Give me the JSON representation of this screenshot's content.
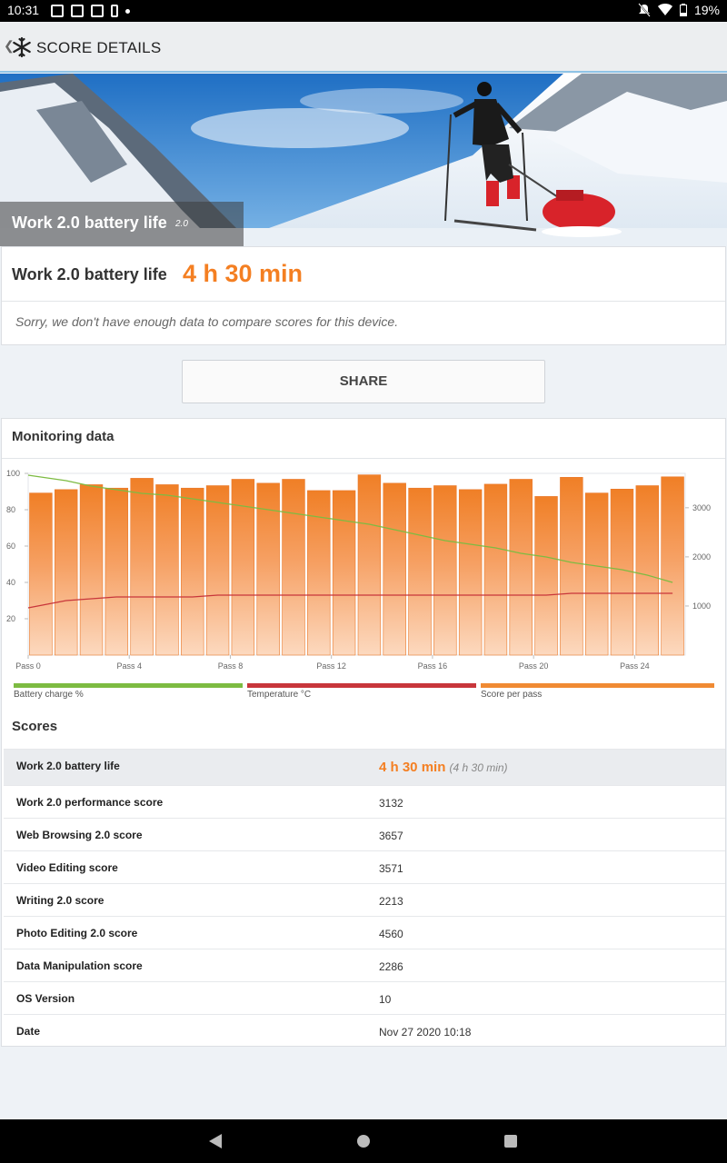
{
  "status_bar": {
    "time": "10:31",
    "battery_pct": "19%"
  },
  "app_bar": {
    "title": "SCORE DETAILS"
  },
  "hero": {
    "title": "Work 2.0 battery life",
    "version": "2.0"
  },
  "result": {
    "label": "Work 2.0 battery life",
    "value": "4 h 30 min",
    "note": "Sorry, we don't have enough data to compare scores for this device."
  },
  "share": {
    "label": "SHARE"
  },
  "monitoring": {
    "heading": "Monitoring data",
    "legend": {
      "battery": "Battery charge %",
      "temperature": "Temperature °C",
      "score": "Score per pass"
    },
    "colors": {
      "battery": "#7dbb42",
      "temperature": "#c8363b",
      "score": "#f08a33"
    }
  },
  "chart_data": {
    "type": "bar",
    "categories": [
      "Pass 0",
      "Pass 1",
      "Pass 2",
      "Pass 3",
      "Pass 4",
      "Pass 5",
      "Pass 6",
      "Pass 7",
      "Pass 8",
      "Pass 9",
      "Pass 10",
      "Pass 11",
      "Pass 12",
      "Pass 13",
      "Pass 14",
      "Pass 15",
      "Pass 16",
      "Pass 17",
      "Pass 18",
      "Pass 19",
      "Pass 20",
      "Pass 21",
      "Pass 22",
      "Pass 23",
      "Pass 24",
      "Pass 25"
    ],
    "x_tick_labels": [
      "Pass 0",
      "Pass 4",
      "Pass 8",
      "Pass 12",
      "Pass 16",
      "Pass 20",
      "Pass 24"
    ],
    "left_ticks": [
      "100",
      "80",
      "60",
      "40",
      "20"
    ],
    "right_ticks": [
      "3000",
      "2000",
      "1000"
    ],
    "left_ylim": [
      0,
      100
    ],
    "right_ylim": [
      0,
      3700
    ],
    "series": [
      {
        "name": "Score per pass",
        "axis": "right",
        "values": [
          3300,
          3370,
          3470,
          3400,
          3600,
          3470,
          3400,
          3450,
          3580,
          3500,
          3580,
          3350,
          3350,
          3670,
          3500,
          3400,
          3450,
          3370,
          3480,
          3580,
          3230,
          3620,
          3300,
          3380,
          3450,
          3630
        ]
      },
      {
        "name": "Battery charge %",
        "axis": "left",
        "values": [
          99,
          96,
          93,
          91,
          89,
          88,
          86,
          84,
          82,
          80,
          78,
          76,
          74,
          72,
          69,
          66,
          63,
          61,
          59,
          56,
          54,
          51,
          49,
          47,
          44,
          40
        ]
      },
      {
        "name": "Temperature °C",
        "axis": "left",
        "values": [
          26,
          30,
          31,
          32,
          32,
          32,
          32,
          33,
          33,
          33,
          33,
          33,
          33,
          33,
          33,
          33,
          33,
          33,
          33,
          33,
          33,
          34,
          34,
          34,
          34,
          34
        ]
      }
    ],
    "grid": false
  },
  "scores": {
    "heading": "Scores",
    "rows": [
      {
        "key": "Work 2.0 battery life",
        "value": "4 h 30 min",
        "sub": "(4 h 30 min)"
      },
      {
        "key": "Work 2.0 performance score",
        "value": "3132"
      },
      {
        "key": "Web Browsing 2.0 score",
        "value": "3657"
      },
      {
        "key": "Video Editing score",
        "value": "3571"
      },
      {
        "key": "Writing 2.0 score",
        "value": "2213"
      },
      {
        "key": "Photo Editing 2.0 score",
        "value": "4560"
      },
      {
        "key": "Data Manipulation score",
        "value": "2286"
      },
      {
        "key": "OS Version",
        "value": "10"
      },
      {
        "key": "Date",
        "value": "Nov 27 2020 10:18"
      }
    ]
  }
}
